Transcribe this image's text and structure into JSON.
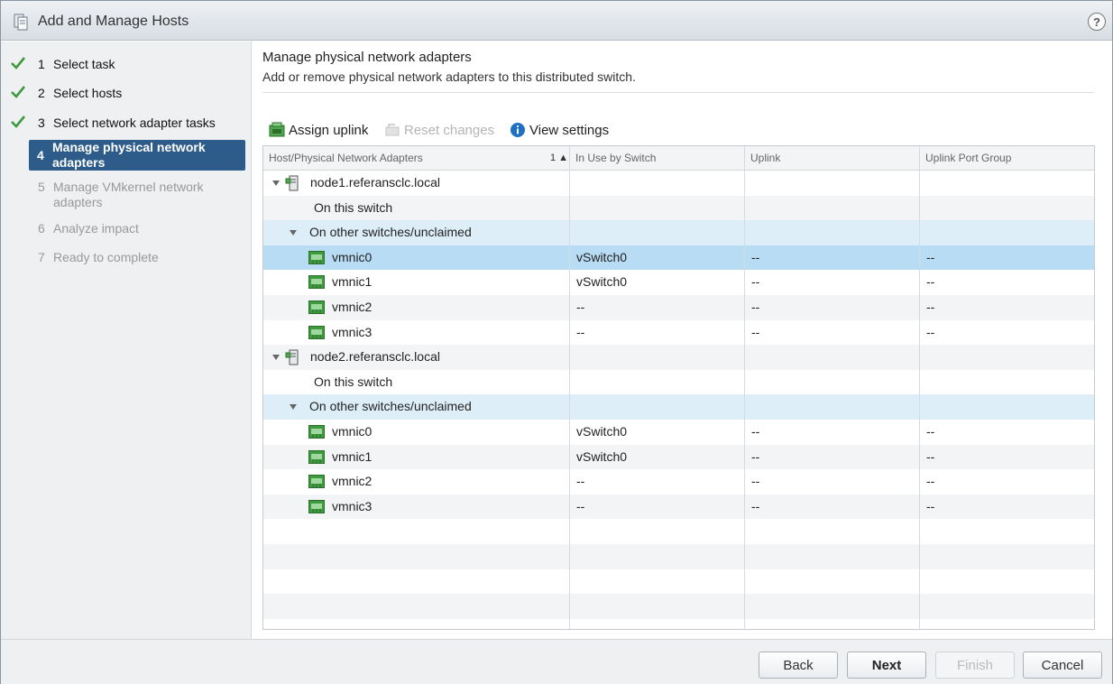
{
  "dialog": {
    "title": "Add and Manage Hosts",
    "help_label": "?"
  },
  "steps": [
    {
      "num": "1",
      "label": "Select task",
      "state": "done"
    },
    {
      "num": "2",
      "label": "Select hosts",
      "state": "done"
    },
    {
      "num": "3",
      "label": "Select network adapter tasks",
      "state": "done"
    },
    {
      "num": "4",
      "label": "Manage physical network adapters",
      "state": "active"
    },
    {
      "num": "5",
      "label": "Manage VMkernel network adapters",
      "state": "pending"
    },
    {
      "num": "6",
      "label": "Analyze impact",
      "state": "pending"
    },
    {
      "num": "7",
      "label": "Ready to complete",
      "state": "pending"
    }
  ],
  "main": {
    "heading": "Manage physical network adapters",
    "subheading": "Add or remove physical network adapters to this distributed switch."
  },
  "toolbar": {
    "assign_uplink": "Assign uplink",
    "reset_changes": "Reset changes",
    "view_settings": "View settings"
  },
  "grid": {
    "columns": [
      "Host/Physical Network Adapters",
      "In Use by Switch",
      "Uplink",
      "Uplink Port Group"
    ],
    "sort_indicator": "1 ▲",
    "rows": [
      {
        "type": "host",
        "name": "node1.referansclc.local"
      },
      {
        "type": "section",
        "name": "On this switch",
        "expandable": false
      },
      {
        "type": "section",
        "name": "On other switches/unclaimed",
        "expandable": true
      },
      {
        "type": "nic",
        "name": "vmnic0",
        "switch": "vSwitch0",
        "uplink": "--",
        "group": "--",
        "selected": true
      },
      {
        "type": "nic",
        "name": "vmnic1",
        "switch": "vSwitch0",
        "uplink": "--",
        "group": "--"
      },
      {
        "type": "nic",
        "name": "vmnic2",
        "switch": "--",
        "uplink": "--",
        "group": "--"
      },
      {
        "type": "nic",
        "name": "vmnic3",
        "switch": "--",
        "uplink": "--",
        "group": "--"
      },
      {
        "type": "host",
        "name": "node2.referansclc.local"
      },
      {
        "type": "section",
        "name": "On this switch",
        "expandable": false
      },
      {
        "type": "section",
        "name": "On other switches/unclaimed",
        "expandable": true
      },
      {
        "type": "nic",
        "name": "vmnic0",
        "switch": "vSwitch0",
        "uplink": "--",
        "group": "--"
      },
      {
        "type": "nic",
        "name": "vmnic1",
        "switch": "vSwitch0",
        "uplink": "--",
        "group": "--"
      },
      {
        "type": "nic",
        "name": "vmnic2",
        "switch": "--",
        "uplink": "--",
        "group": "--"
      },
      {
        "type": "nic",
        "name": "vmnic3",
        "switch": "--",
        "uplink": "--",
        "group": "--"
      }
    ]
  },
  "footer": {
    "back": "Back",
    "next": "Next",
    "finish": "Finish",
    "cancel": "Cancel"
  },
  "colors": {
    "active_step": "#2d5b8a",
    "selected_row": "#b8dcf4",
    "group_row": "#ddeef9",
    "check": "#3c9a3c",
    "info": "#1f6fc4"
  }
}
